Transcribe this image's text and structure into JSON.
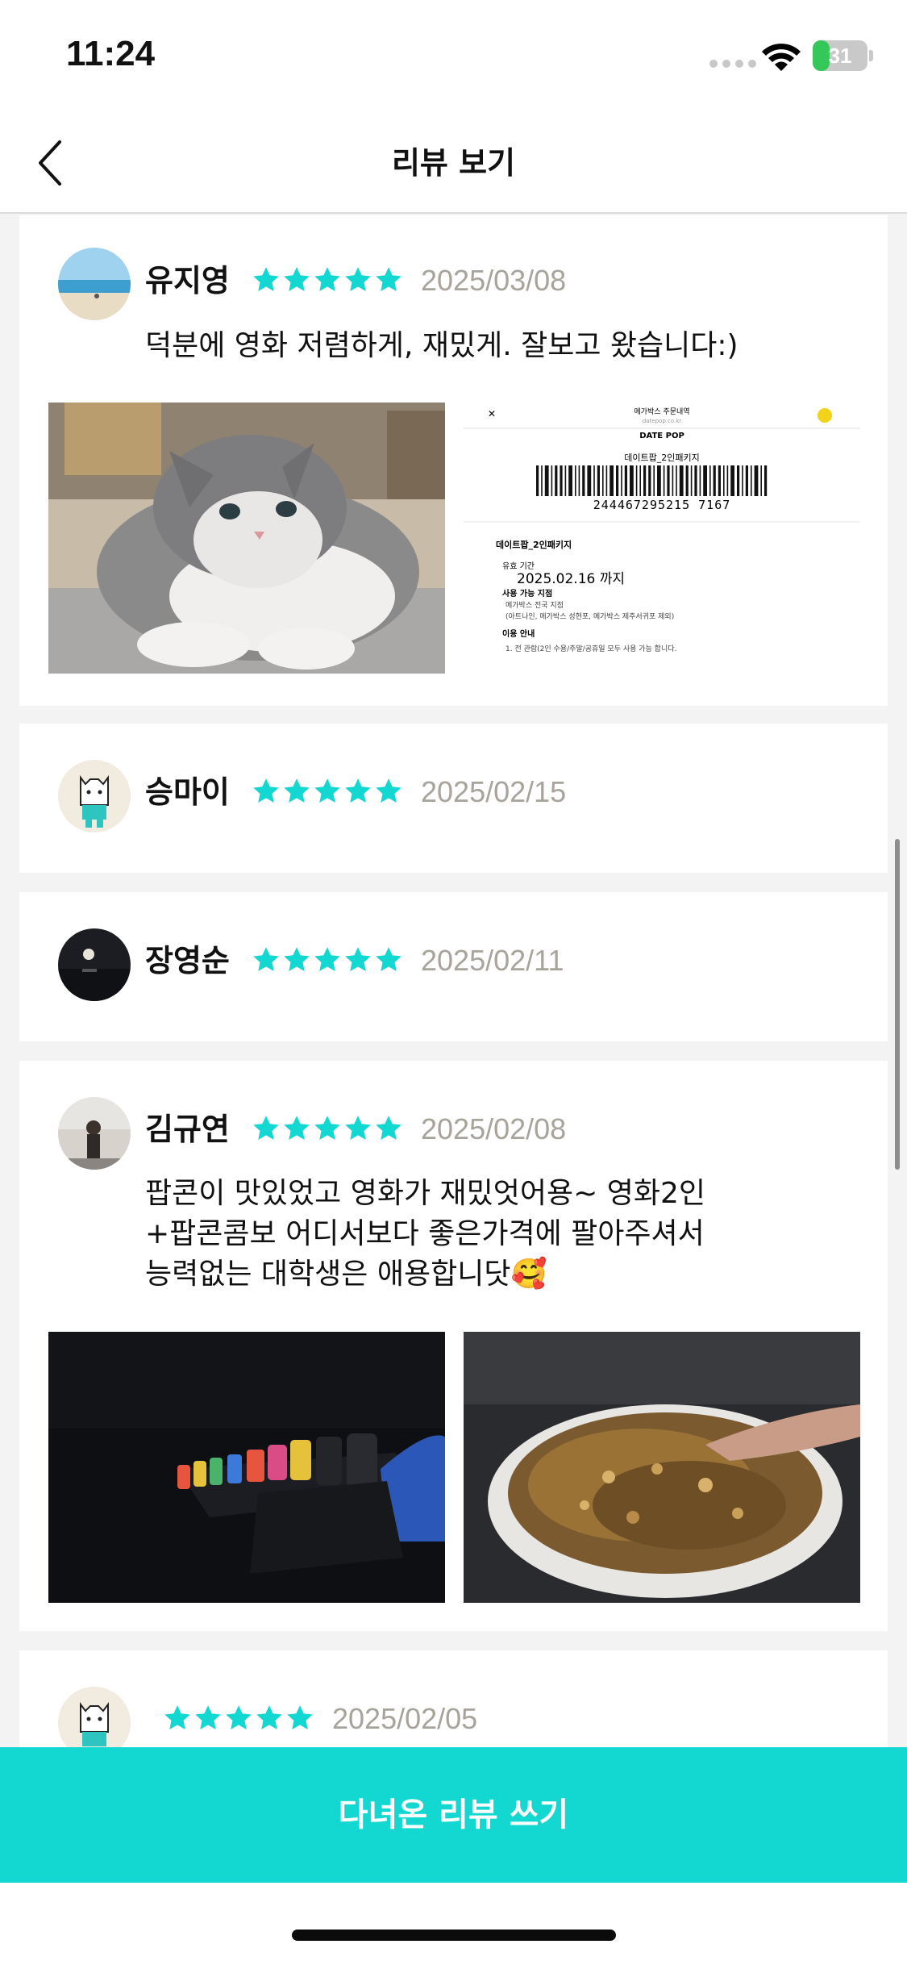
{
  "status_bar": {
    "time": "11:24",
    "battery": "31",
    "battery_level": 0.31
  },
  "nav": {
    "title": "리뷰 보기",
    "back_icon": "chevron-left-icon"
  },
  "reviews": [
    {
      "name": "유지영",
      "rating": 5,
      "date": "2025/03/08",
      "text": [
        "덕분에 영화 저렴하게, 재밌게. 잘보고 왔습니다:)"
      ],
      "photos": [
        {
          "kind": "kitten-photo"
        },
        {
          "kind": "ticket-screenshot",
          "header": "메가박스 주문내역",
          "site": "datepop.co.kr",
          "brand": "DATE POP",
          "package": "데이트팝_2인패키지",
          "barcode_number": "244467295215 7167",
          "section_title": "데이트팝_2인패키지",
          "validity_label": "유효 기간",
          "validity": "2025.02.16 까지",
          "branch_label": "사용 가능 지점",
          "branch": "메가박스 전국 지점",
          "branch_note": "(아트나인, 메가박스 성현포, 메가박스 제주서귀포 제외)",
          "guide_label": "이용 안내",
          "guide": "1. 전 관람(2인 수용/주말/공휴일 모두 사용 가능 합니다."
        }
      ]
    },
    {
      "name": "승마이",
      "rating": 5,
      "date": "2025/02/15",
      "text": [],
      "photos": []
    },
    {
      "name": "장영순",
      "rating": 5,
      "date": "2025/02/11",
      "text": [],
      "photos": []
    },
    {
      "name": "김규연",
      "rating": 5,
      "date": "2025/02/08",
      "text": [
        "팝콘이 맛있었고 영화가 재밌엇어용~ 영화2인",
        "+팝콘콤보 어디서보다 좋은가격에 팔아주셔서",
        "능력없는 대학생은 애용합니닷🥰"
      ],
      "photos": [
        {
          "kind": "theater-seats-photo"
        },
        {
          "kind": "popcorn-photo"
        }
      ]
    },
    {
      "name": "",
      "rating": 5,
      "date": "2025/02/05",
      "text": [],
      "photos": []
    }
  ],
  "cta": {
    "label": "다녀온 리뷰 쓰기"
  },
  "colors": {
    "accent": "#13d8d1",
    "star": "#13d8d1",
    "date": "#a8a39b"
  }
}
